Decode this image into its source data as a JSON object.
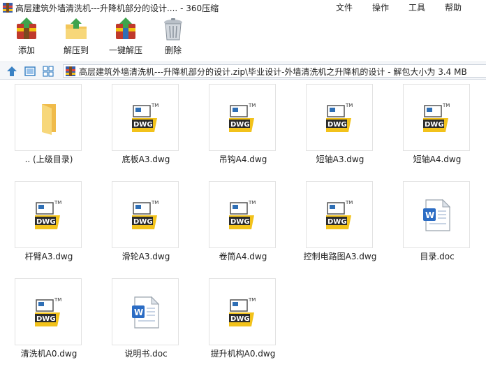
{
  "window": {
    "title": "高层建筑外墙清洗机---升降机部分的设计.... - 360压缩"
  },
  "menu": [
    {
      "label": "文件"
    },
    {
      "label": "操作"
    },
    {
      "label": "工具"
    },
    {
      "label": "帮助"
    }
  ],
  "toolbar": [
    {
      "label": "添加",
      "icon": "add-archive-icon"
    },
    {
      "label": "解压到",
      "icon": "extract-to-folder-icon"
    },
    {
      "label": "一键解压",
      "icon": "one-click-extract-icon"
    },
    {
      "label": "删除",
      "icon": "trash-bin-icon"
    }
  ],
  "address": {
    "path": "高层建筑外墙清洗机---升降机部分的设计.zip\\毕业设计-外墙清洗机之升降机的设计 - 解包大小为 3.4 MB"
  },
  "files": [
    {
      "name": ".. (上级目录)",
      "type": "folder"
    },
    {
      "name": "底板A3.dwg",
      "type": "dwg"
    },
    {
      "name": "吊钩A4.dwg",
      "type": "dwg"
    },
    {
      "name": "短轴A3.dwg",
      "type": "dwg"
    },
    {
      "name": "短轴A4.dwg",
      "type": "dwg"
    },
    {
      "name": "杆臂A3.dwg",
      "type": "dwg"
    },
    {
      "name": "滑轮A3.dwg",
      "type": "dwg"
    },
    {
      "name": "卷筒A4.dwg",
      "type": "dwg"
    },
    {
      "name": "控制电路图A3.dwg",
      "type": "dwg"
    },
    {
      "name": "目录.doc",
      "type": "doc"
    },
    {
      "name": "清洗机A0.dwg",
      "type": "dwg"
    },
    {
      "name": "说明书.doc",
      "type": "doc"
    },
    {
      "name": "提升机构A0.dwg",
      "type": "dwg"
    }
  ],
  "colors": {
    "dwg_yellow": "#f2c21b",
    "dwg_dark": "#2b2b2b",
    "dwg_blue": "#2f6fb5",
    "folder": "#f3c65a",
    "word_blue": "#2b6cc4"
  }
}
